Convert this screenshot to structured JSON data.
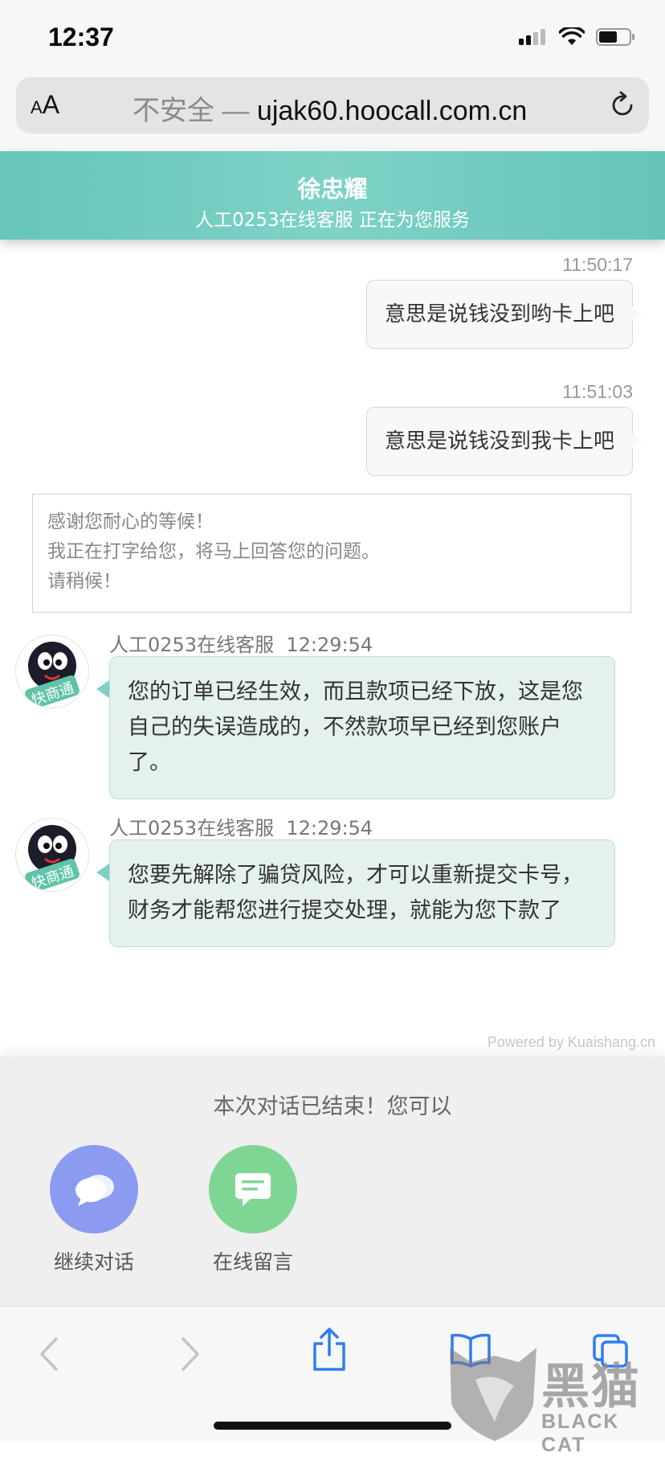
{
  "status_bar": {
    "time": "12:37"
  },
  "browser": {
    "text_size_label": "AA",
    "insecure_label": "不安全 —",
    "domain": "ujak60.hoocall.com.cn"
  },
  "chat_header": {
    "agent_name": "徐忠耀",
    "agent_status": "人工0253在线客服 正在为您服务"
  },
  "user_messages": [
    {
      "time": "11:50:17",
      "text": "意思是说钱没到哟卡上吧"
    },
    {
      "time": "11:51:03",
      "text": "意思是说钱没到我卡上吧"
    }
  ],
  "system_notice": {
    "lines": [
      "感谢您耐心的等候！",
      "我正在打字给您，将马上回答您的问题。",
      "请稍候！"
    ]
  },
  "agent_messages": [
    {
      "sender": "人工0253在线客服",
      "time": "12:29:54",
      "text": "您的订单已经生效，而且款项已经下放，这是您自己的失误造成的，不然款项早已经到您账户了。"
    },
    {
      "sender": "人工0253在线客服",
      "time": "12:29:54",
      "text": "您要先解除了骗贷风险，才可以重新提交卡号，财务才能帮您进行提交处理，就能为您下款了"
    }
  ],
  "avatar_badge": "快商通",
  "footer": {
    "powered_by": "Powered by Kuaishang.cn",
    "ended_text": "本次对话已结束！您可以",
    "continue_label": "继续对话",
    "message_label": "在线留言"
  },
  "watermark": {
    "cn": "黑猫",
    "en": "BLACK CAT"
  },
  "colors": {
    "header_teal": "#6cc8bc",
    "agent_bubble": "#e4f1ef",
    "continue_button": "#8b9bf0",
    "message_button": "#7fd694",
    "link_blue": "#2f7df6"
  }
}
